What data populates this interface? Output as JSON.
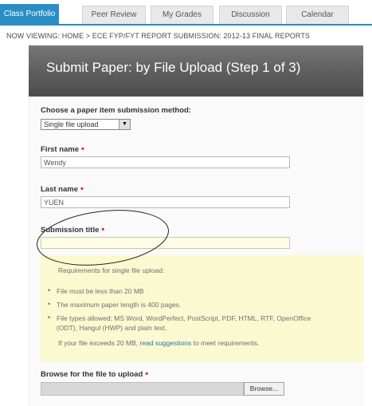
{
  "tabs": [
    {
      "label": "Class Portfolio",
      "active": true
    },
    {
      "label": "Peer Review",
      "active": false
    },
    {
      "label": "My Grades",
      "active": false
    },
    {
      "label": "Discussion",
      "active": false
    },
    {
      "label": "Calendar",
      "active": false
    }
  ],
  "breadcrumb": "NOW VIEWING: HOME > ECE FYP/FYT REPORT SUBMISSION: 2012-13 FINAL REPORTS",
  "header": {
    "title": "Submit Paper: by File Upload (Step 1 of 3)"
  },
  "form": {
    "method_label": "Choose a paper item submission method:",
    "method_value": "Single file upload",
    "first_name_label": "First name",
    "first_name_value": "Wendy",
    "last_name_label": "Last name",
    "last_name_value": "YUEN",
    "submission_title_label": "Submission title",
    "submission_title_value": "",
    "browse_label": "Browse for the file to upload",
    "browse_button": "Browse..."
  },
  "requirements": {
    "heading": "Requirements for single file upload:",
    "items": [
      "File must be less than 20 MB",
      "The maximum paper length is 400 pages.",
      "File types allowed: MS Word, WordPerfect, PostScript, PDF, HTML, RTF, OpenOffice",
      "(ODT), Hangul (HWP) and plain text."
    ],
    "note_prefix": "If your file exceeds 20 MB,",
    "note_link": "read suggestions",
    "note_suffix": "to meet requirements."
  },
  "colors": {
    "accent": "#2a8ec6",
    "required": "#e0202a",
    "info_bg": "#fbf9cf"
  }
}
